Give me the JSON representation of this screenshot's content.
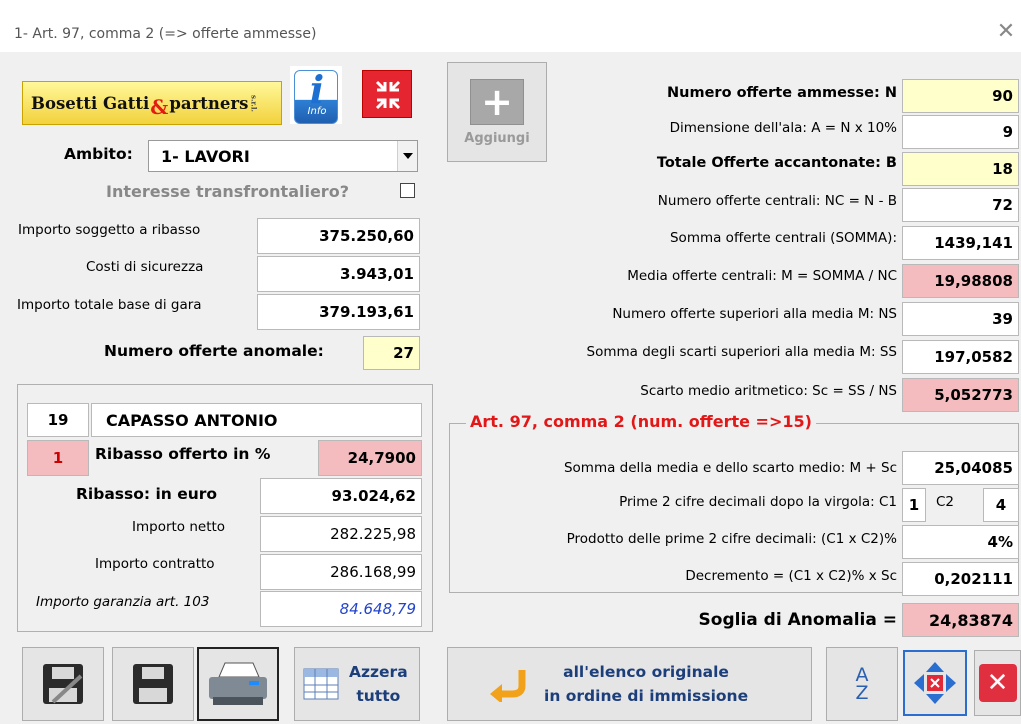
{
  "window": {
    "title": "1- Art. 97, comma 2 (=> offerte ammesse)",
    "close_glyph": "✕"
  },
  "logo": {
    "text": "Bosetti Gatti",
    "amp": "&",
    "partners": "partners",
    "srl": "s.r.l."
  },
  "info_button": {
    "label": "Info",
    "glyph": "i"
  },
  "add_button": {
    "label": "Aggiungi",
    "glyph": "+"
  },
  "ambito": {
    "label": "Ambito:",
    "value": "1- LAVORI"
  },
  "transfrontaliero": {
    "label": "Interesse transfrontaliero?"
  },
  "importi": {
    "soggetto_label": "Importo soggetto a ribasso",
    "soggetto_value": "375.250,60",
    "sicurezza_label": "Costi di sicurezza",
    "sicurezza_value": "3.943,01",
    "totale_label": "Importo totale base di gara",
    "totale_value": "379.193,61",
    "anomale_label": "Numero offerte anomale:",
    "anomale_value": "27"
  },
  "offerente": {
    "numero": "19",
    "nome": "CAPASSO ANTONIO",
    "posizione": "1",
    "ribasso_pct_label": "Ribasso offerto in %",
    "ribasso_pct_value": "24,7900",
    "ribasso_euro_label": "Ribasso: in euro",
    "ribasso_euro_value": "93.024,62",
    "netto_label": "Importo netto",
    "netto_value": "282.225,98",
    "contratto_label": "Importo contratto",
    "contratto_value": "286.168,99",
    "garanzia_label": "Importo garanzia art. 103",
    "garanzia_value": "84.648,79"
  },
  "calcoli": {
    "n_label": "Numero offerte ammesse: N",
    "n_value": "90",
    "ala_label": "Dimensione dell'ala: A = N x 10%",
    "ala_value": "9",
    "b_label": "Totale Offerte accantonate: B",
    "b_value": "18",
    "nc_label": "Numero offerte centrali: NC = N - B",
    "nc_value": "72",
    "somma_label": "Somma offerte centrali (SOMMA):",
    "somma_value": "1439,141",
    "media_label": "Media offerte centrali: M = SOMMA / NC",
    "media_value": "19,98808",
    "ns_label": "Numero offerte superiori alla media M: NS",
    "ns_value": "39",
    "ss_label": "Somma degli scarti superiori alla media M: SS",
    "ss_value": "197,0582",
    "sc_label": "Scarto medio aritmetico: Sc = SS / NS",
    "sc_value": "5,052773"
  },
  "art97": {
    "title": "Art. 97, comma 2 (num. offerte =>15)",
    "msc_label": "Somma della media e dello scarto medio: M + Sc",
    "msc_value": "25,04085",
    "c1_label": "Prime 2 cifre decimali dopo la virgola: C1",
    "c1_value": "1",
    "c2_label": "C2",
    "c2_value": "4",
    "prod_label": "Prodotto delle prime 2 cifre decimali: (C1 x C2)%",
    "prod_value": "4%",
    "dec_label": "Decremento = (C1 x C2)% x Sc",
    "dec_value": "0,202111"
  },
  "soglia": {
    "label": "Soglia di Anomalia =",
    "value": "24,83874"
  },
  "bottom": {
    "azzera_line1": "Azzera",
    "azzera_line2": "tutto",
    "elenco_line1": "all'elenco originale",
    "elenco_line2": "in ordine di immissione",
    "sort_a": "A",
    "sort_z": "Z"
  }
}
